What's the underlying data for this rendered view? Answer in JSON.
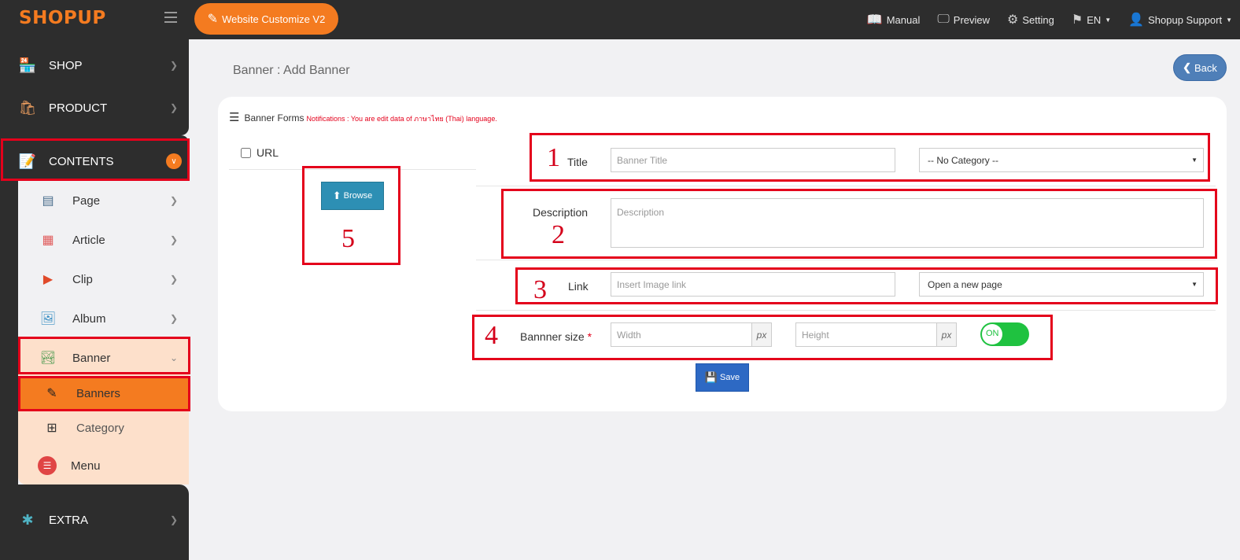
{
  "topbar": {
    "logo": "SHOPUP",
    "customize_label": "Website Customize V2",
    "nav": [
      {
        "label": "Manual",
        "icon": "book-icon"
      },
      {
        "label": "Preview",
        "icon": "monitor-icon"
      },
      {
        "label": "Setting",
        "icon": "gear-icon"
      },
      {
        "label": "EN",
        "icon": "flag-icon"
      },
      {
        "label": "Shopup Support",
        "icon": "user-icon"
      }
    ]
  },
  "sidebar": {
    "shop": "SHOP",
    "product": "PRODUCT",
    "contents": "CONTENTS",
    "page": "Page",
    "article": "Article",
    "clip": "Clip",
    "album": "Album",
    "banner": "Banner",
    "banners": "Banners",
    "category": "Category",
    "menu": "Menu",
    "extra": "EXTRA"
  },
  "main": {
    "page_title": "Banner : Add Banner",
    "back_label": "Back",
    "panel_title": "Banner Forms",
    "notification": "Notifications : You are edit data of ภาษาไทย (Thai) language.",
    "url_label": "URL",
    "browse_label": "Browse",
    "annotations": [
      "1",
      "2",
      "3",
      "4",
      "5"
    ],
    "title_label": "Title",
    "title_placeholder": "Banner Title",
    "category_value": "-- No Category --",
    "description_label": "Description",
    "description_placeholder": "Description",
    "link_label": "Link",
    "link_placeholder": "Insert Image link",
    "link_target_value": "Open a new page",
    "size_label": "Bannner size",
    "required_mark": "*",
    "width_placeholder": "Width",
    "height_placeholder": "Height",
    "unit": "px",
    "toggle_label": "ON",
    "save_label": "Save"
  },
  "colors": {
    "accent": "#f47b20",
    "topbar": "#2d2d2d",
    "annotation": "#e4001b",
    "toggle_on": "#1fc240",
    "save": "#2d69c4",
    "browse": "#2d8fb4",
    "back": "#4f7fb8"
  }
}
